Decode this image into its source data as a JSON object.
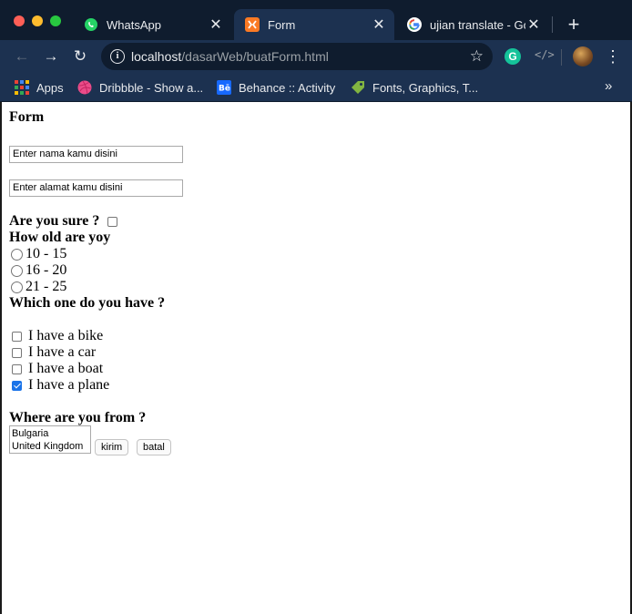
{
  "browser": {
    "tabs": [
      {
        "title": "WhatsApp",
        "icon": "whatsapp-icon"
      },
      {
        "title": "Form",
        "icon": "xampp-icon"
      },
      {
        "title": "ujian translate - Goo",
        "icon": "google-icon"
      }
    ],
    "address": {
      "host": "localhost",
      "path": "/dasarWeb/buatForm.html"
    },
    "bookmarks": [
      {
        "label": "Apps",
        "icon": "apps-grid-icon"
      },
      {
        "label": "Dribbble - Show a...",
        "icon": "dribbble-icon"
      },
      {
        "label": "Behance :: Activity",
        "icon": "behance-icon"
      },
      {
        "label": "Fonts, Graphics, T...",
        "icon": "tag-icon"
      }
    ],
    "glyphs": {
      "close": "✕",
      "new_tab": "+",
      "back": "←",
      "forward": "→",
      "reload": "↻",
      "star": "☆",
      "menu": "⋮",
      "more": "»",
      "grammarly": "G",
      "code": "</>",
      "info": "i"
    }
  },
  "form": {
    "heading": "Form",
    "name_placeholder": "Enter nama kamu disini",
    "address_placeholder": "Enter alamat kamu disini",
    "sure_question": "Are you sure ?",
    "age_question": "How old are yoy",
    "age_options": [
      "10 - 15",
      "16 - 20",
      "21 - 25"
    ],
    "have_question": "Which one do you have ?",
    "have_options": [
      {
        "label": "I have a bike",
        "checked": false
      },
      {
        "label": "I have a car",
        "checked": false
      },
      {
        "label": "I have a boat",
        "checked": false
      },
      {
        "label": "I have a plane",
        "checked": true
      }
    ],
    "from_question": "Where are you from ?",
    "countries": [
      "Bulgaria",
      "United Kingdom"
    ],
    "submit_label": "kirim",
    "reset_label": "batal"
  },
  "colors": {
    "chrome_dark": "#0f1c2e",
    "chrome": "#1c3150",
    "accent": "#1a73e8"
  }
}
